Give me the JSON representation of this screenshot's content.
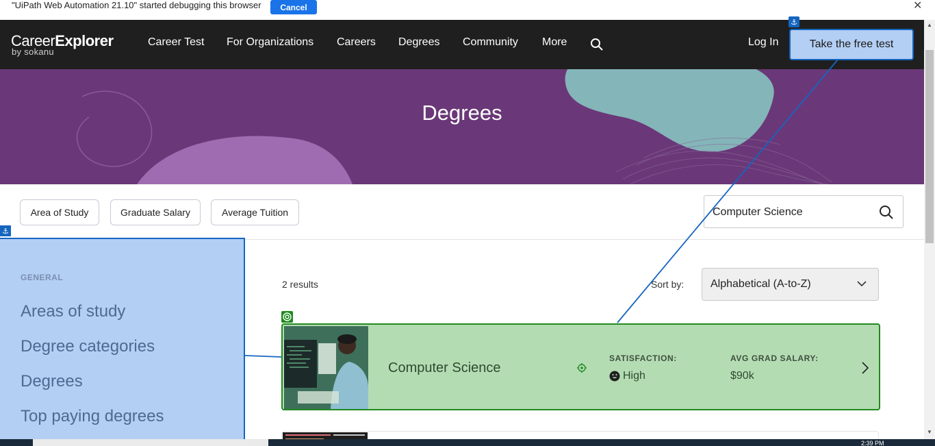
{
  "debugbar": {
    "message": "\"UiPath Web Automation 21.10\" started debugging this browser",
    "cancel_label": "Cancel",
    "close_glyph": "✕"
  },
  "nav": {
    "logo_part1": "Career",
    "logo_part2": "Explorer",
    "logo_sub": "by sokanu",
    "items": [
      "Career Test",
      "For Organizations",
      "Careers",
      "Degrees",
      "Community",
      "More"
    ],
    "login_label": "Log In",
    "cta_label": "Take the free test"
  },
  "hero": {
    "title": "Degrees"
  },
  "filters": {
    "chips": [
      "Area of Study",
      "Graduate Salary",
      "Average Tuition"
    ],
    "search_value": "Computer Science"
  },
  "sidebar": {
    "heading": "GENERAL",
    "items": [
      "Areas of study",
      "Degree categories",
      "Degrees",
      "Top paying degrees"
    ]
  },
  "results": {
    "count_text": "2 results",
    "sort_label": "Sort by:",
    "sort_value": "Alphabetical (A-to-Z)",
    "cards": [
      {
        "title": "Computer Science",
        "satisfaction_label": "SATISFACTION:",
        "satisfaction_value": "High",
        "salary_label": "AVG GRAD SALARY:",
        "salary_value": "$90k"
      }
    ]
  },
  "taskbar": {
    "clock": "2:39 PM"
  },
  "colors": {
    "nav_bg": "#1f1f1f",
    "hero_bg": "#6a3878",
    "highlight_blue": "#b3cff3",
    "highlight_blue_border": "#1565c0",
    "highlight_green": "#b4dcb3",
    "highlight_green_border": "#208a20"
  },
  "icons": {
    "nav_search": "search-icon",
    "filter_search": "search-icon",
    "sort_chevron": "chevron-down-icon",
    "card_arrow": "chevron-right-icon",
    "satisfaction": "smiley-icon",
    "anchor": "anchor-icon",
    "target": "target-icon"
  }
}
